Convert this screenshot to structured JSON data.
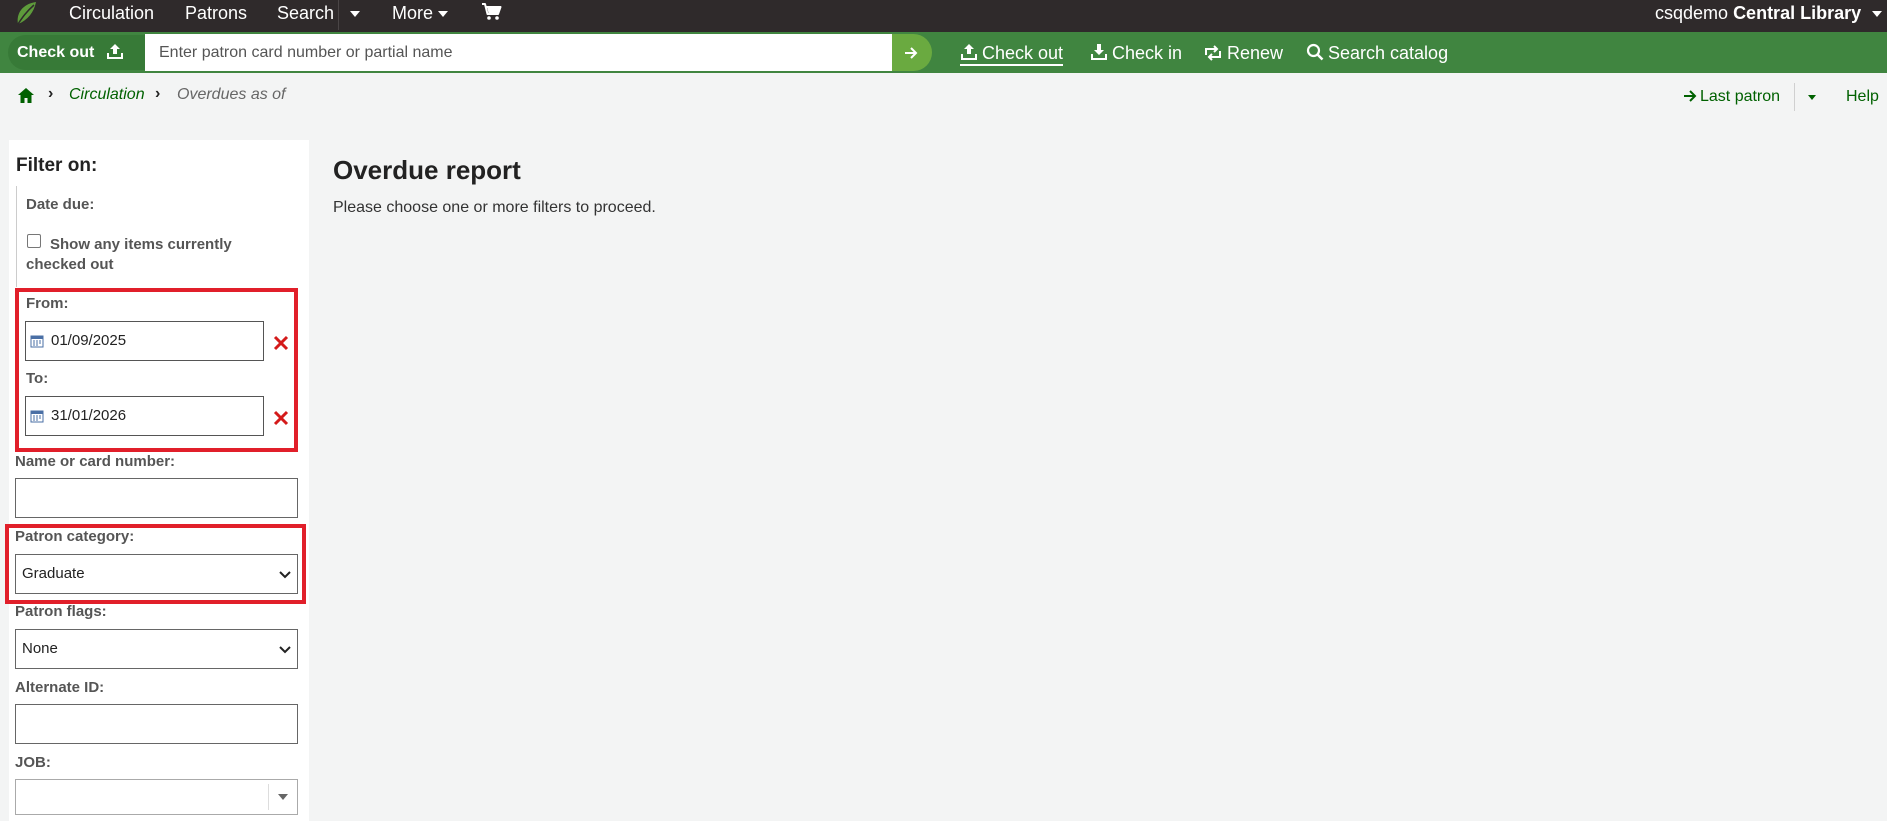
{
  "topnav": {
    "circulation": "Circulation",
    "patrons": "Patrons",
    "search": "Search",
    "more": "More",
    "user": "csqdemo",
    "library": "Central Library"
  },
  "checkbar": {
    "tab_label": "Check out",
    "input_placeholder": "Enter patron card number or partial name",
    "links": {
      "checkout": "Check out",
      "checkin": "Check in",
      "renew": "Renew",
      "search_catalog": "Search catalog"
    }
  },
  "breadcrumb": {
    "circulation": "Circulation",
    "current": "Overdues as of"
  },
  "header_right": {
    "last_patron": "Last patron",
    "help": "Help"
  },
  "sidebar": {
    "title": "Filter on:",
    "date_due_label": "Date due:",
    "show_any_label": "Show any items currently checked out",
    "from_label": "From:",
    "from_value": "01/09/2025",
    "to_label": "To:",
    "to_value": "31/01/2026",
    "name_label": "Name or card number:",
    "patron_category_label": "Patron category:",
    "patron_category_value": "Graduate",
    "patron_flags_label": "Patron flags:",
    "patron_flags_value": "None",
    "alternate_id_label": "Alternate ID:",
    "job_label": "JOB:"
  },
  "main": {
    "title": "Overdue report",
    "message": "Please choose one or more filters to proceed."
  },
  "colors": {
    "topbar": "#2f2a2b",
    "checkbar": "#408540",
    "link": "#006100",
    "highlight": "#e11f2a"
  }
}
